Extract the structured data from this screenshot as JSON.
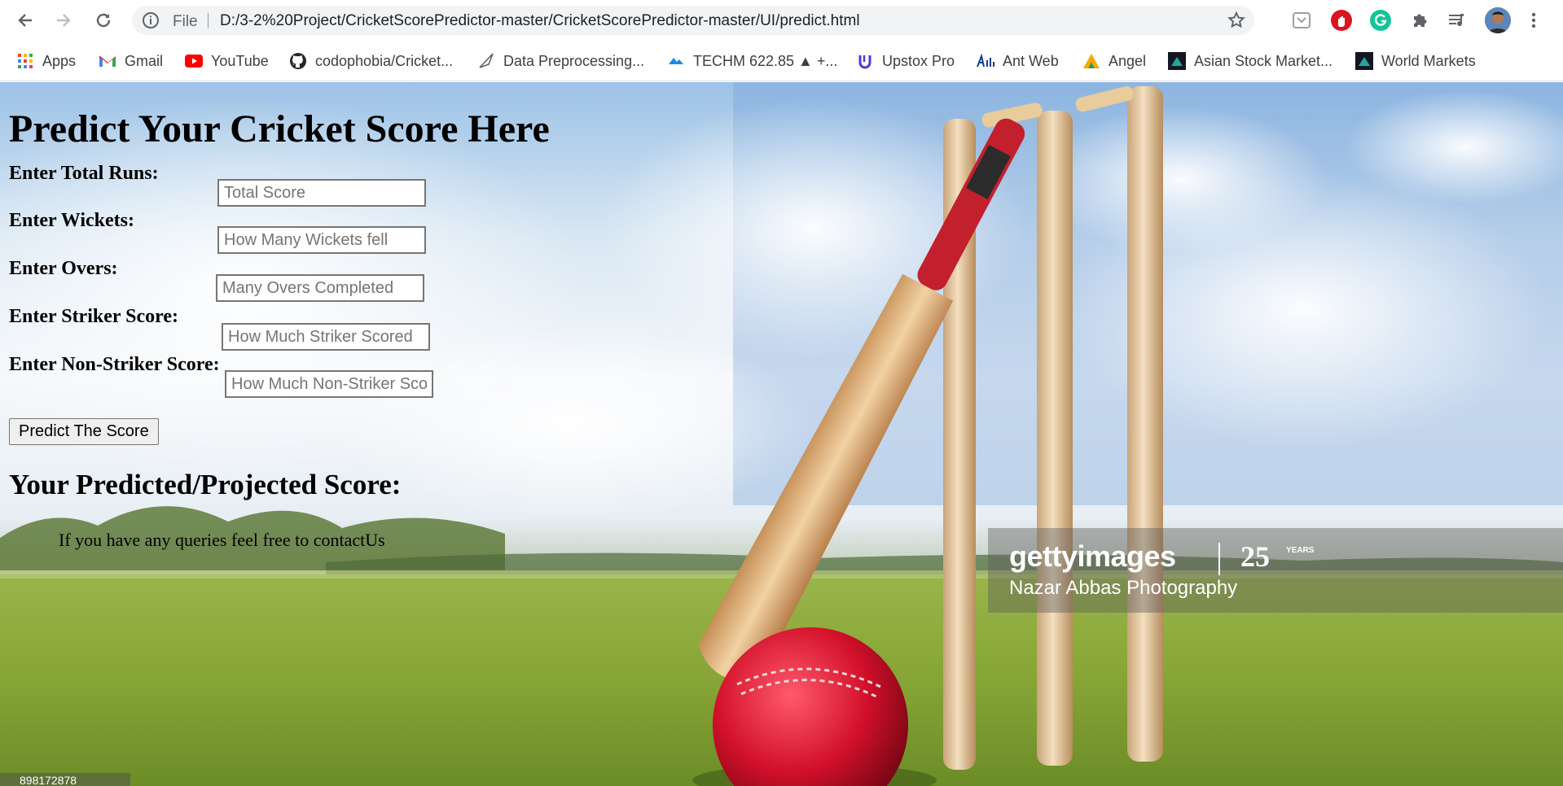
{
  "browser": {
    "url_scheme_label": "File",
    "url": "D:/3-2%20Project/CricketScorePredictor-master/CricketScorePredictor-master/UI/predict.html"
  },
  "bookmarks": [
    {
      "label": "Apps",
      "icon": "apps-grid-icon"
    },
    {
      "label": "Gmail",
      "icon": "gmail-icon"
    },
    {
      "label": "YouTube",
      "icon": "youtube-icon"
    },
    {
      "label": "codophobia/Cricket...",
      "icon": "github-icon"
    },
    {
      "label": "Data Preprocessing...",
      "icon": "triangle-icon"
    },
    {
      "label": "TECHM 622.85 ▲ +...",
      "icon": "cloud-icon"
    },
    {
      "label": "Upstox Pro",
      "icon": "upstox-icon"
    },
    {
      "label": "Ant Web",
      "icon": "antweb-icon"
    },
    {
      "label": "Angel",
      "icon": "angel-icon"
    },
    {
      "label": "Asian Stock Market...",
      "icon": "tradingview-icon"
    },
    {
      "label": "World Markets",
      "icon": "tradingview-icon"
    }
  ],
  "page": {
    "title": "Predict Your Cricket Score Here",
    "fields": [
      {
        "label": "Enter Total Runs:",
        "placeholder": "Total Score"
      },
      {
        "label": "Enter Wickets:",
        "placeholder": "How Many Wickets fell"
      },
      {
        "label": "Enter Overs:",
        "placeholder": "Many Overs Completed"
      },
      {
        "label": "Enter Striker Score:",
        "placeholder": "How Much Striker Scored"
      },
      {
        "label": "Enter Non-Striker Score:",
        "placeholder": "How Much Non-Striker Scored"
      }
    ],
    "submit_label": "Predict The Score",
    "result_heading": "Your Predicted/Projected Score:",
    "contact_text": "If you have any queries feel free to contactUs"
  },
  "watermark": {
    "brand": "gettyimages",
    "anniversary": "25",
    "anniversary_suffix": "YEARS",
    "credit": "Nazar Abbas Photography",
    "image_id": "898172878"
  }
}
